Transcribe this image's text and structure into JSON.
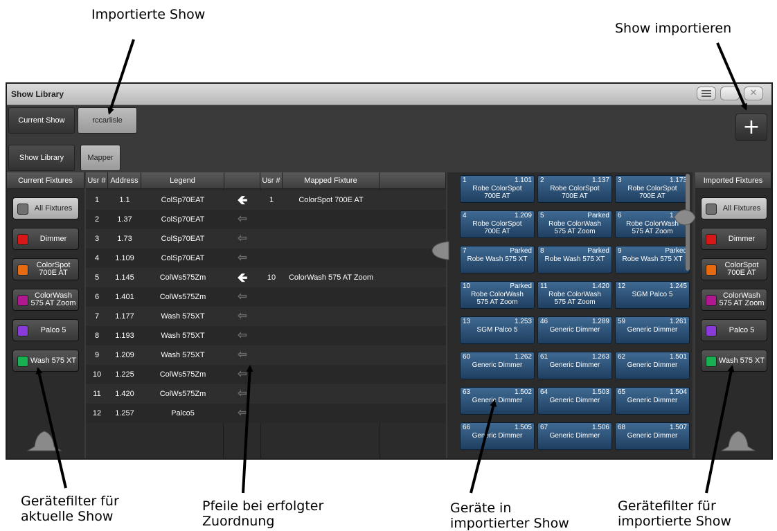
{
  "annotations": {
    "imported_show": "Importierte Show",
    "import_show": "Show importieren",
    "filter_current_1": "Gerätefilter für",
    "filter_current_2": "aktuelle Show",
    "arrows_1": "Pfeile bei erfolgter",
    "arrows_2": "Zuordnung",
    "fixtures_imported_1": "Geräte in",
    "fixtures_imported_2": "importierter Show",
    "filter_imported_1": "Gerätefilter für",
    "filter_imported_2": "importierte Show"
  },
  "window": {
    "title": "Show Library",
    "list_icon": "list-icon",
    "close_icon": "close-icon",
    "close_glyph": "✕"
  },
  "tabs_row1": [
    {
      "label": "Current Show",
      "active": false
    },
    {
      "label": "rccarlisle",
      "active": true
    }
  ],
  "tabs_row2": [
    {
      "label": "Show Library",
      "active": false
    },
    {
      "label": "Mapper",
      "active": true
    }
  ],
  "import_button": {
    "label": "+",
    "icon": "plus-icon"
  },
  "headers": {
    "current_fixtures": "Current Fixtures",
    "usr": "Usr #",
    "address": "Address",
    "legend": "Legend",
    "usr2": "Usr #",
    "mapped_fixture": "Mapped Fixture",
    "imported_fixtures": "Imported Fixtures"
  },
  "current_filters": [
    {
      "label": "All Fixtures",
      "color": "#707070",
      "selected": true
    },
    {
      "label": "Dimmer",
      "color": "#d81818",
      "selected": false
    },
    {
      "label": "ColorSpot\n700E AT",
      "color": "#e86a10",
      "selected": false
    },
    {
      "label": "ColorWash\n575 AT Zoom",
      "color": "#b01890",
      "selected": false
    },
    {
      "label": "Palco 5",
      "color": "#8a3ad8",
      "selected": false
    },
    {
      "label": "Wash 575 XT",
      "color": "#18b050",
      "selected": false
    }
  ],
  "imported_filters": [
    {
      "label": "All Fixtures",
      "color": "#707070",
      "selected": true
    },
    {
      "label": "Dimmer",
      "color": "#d81818",
      "selected": false
    },
    {
      "label": "ColorSpot\n700E AT",
      "color": "#e86a10",
      "selected": false
    },
    {
      "label": "ColorWash\n575 AT Zoom",
      "color": "#b01890",
      "selected": false
    },
    {
      "label": "Palco 5",
      "color": "#8a3ad8",
      "selected": false
    },
    {
      "label": "Wash 575 XT",
      "color": "#18b050",
      "selected": false
    }
  ],
  "mapping_rows": [
    {
      "usr": "1",
      "address": "1.1",
      "legend": "ColSp70EAT",
      "mapped": true,
      "mapped_usr": "1",
      "mapped_fixture": "ColorSpot 700E AT"
    },
    {
      "usr": "2",
      "address": "1.37",
      "legend": "ColSp70EAT",
      "mapped": false,
      "mapped_usr": "",
      "mapped_fixture": ""
    },
    {
      "usr": "3",
      "address": "1.73",
      "legend": "ColSp70EAT",
      "mapped": false,
      "mapped_usr": "",
      "mapped_fixture": ""
    },
    {
      "usr": "4",
      "address": "1.109",
      "legend": "ColSp70EAT",
      "mapped": false,
      "mapped_usr": "",
      "mapped_fixture": ""
    },
    {
      "usr": "5",
      "address": "1.145",
      "legend": "ColWs575Zm",
      "mapped": true,
      "mapped_usr": "10",
      "mapped_fixture": "ColorWash 575 AT Zoom"
    },
    {
      "usr": "6",
      "address": "1.401",
      "legend": "ColWs575Zm",
      "mapped": false,
      "mapped_usr": "",
      "mapped_fixture": ""
    },
    {
      "usr": "7",
      "address": "1.177",
      "legend": "Wash 575XT",
      "mapped": false,
      "mapped_usr": "",
      "mapped_fixture": ""
    },
    {
      "usr": "8",
      "address": "1.193",
      "legend": "Wash 575XT",
      "mapped": false,
      "mapped_usr": "",
      "mapped_fixture": ""
    },
    {
      "usr": "9",
      "address": "1.209",
      "legend": "Wash 575XT",
      "mapped": false,
      "mapped_usr": "",
      "mapped_fixture": ""
    },
    {
      "usr": "10",
      "address": "1.225",
      "legend": "ColWs575Zm",
      "mapped": false,
      "mapped_usr": "",
      "mapped_fixture": ""
    },
    {
      "usr": "11",
      "address": "1.420",
      "legend": "ColWs575Zm",
      "mapped": false,
      "mapped_usr": "",
      "mapped_fixture": ""
    },
    {
      "usr": "12",
      "address": "1.257",
      "legend": "Palco5",
      "mapped": false,
      "mapped_usr": "",
      "mapped_fixture": ""
    }
  ],
  "arrow_glyphs": {
    "mapped": "🡸",
    "unmapped": "⇦"
  },
  "imported_fixture_grid": [
    {
      "num": "1",
      "addr": "1.101",
      "name": "Robe ColorSpot\n700E AT"
    },
    {
      "num": "2",
      "addr": "1.137",
      "name": "Robe ColorSpot\n700E AT"
    },
    {
      "num": "3",
      "addr": "1.173",
      "name": "Robe ColorSpot\n700E AT"
    },
    {
      "num": "4",
      "addr": "1.209",
      "name": "Robe ColorSpot\n700E AT"
    },
    {
      "num": "5",
      "addr": "Parked",
      "name": "Robe ColorWash\n575 AT Zoom"
    },
    {
      "num": "6",
      "addr": "1.401",
      "name": "Robe ColorWash\n575 AT Zoom"
    },
    {
      "num": "7",
      "addr": "Parked",
      "name": "Robe Wash 575 XT"
    },
    {
      "num": "8",
      "addr": "Parked",
      "name": "Robe Wash 575 XT"
    },
    {
      "num": "9",
      "addr": "Parked",
      "name": "Robe Wash 575 XT"
    },
    {
      "num": "10",
      "addr": "Parked",
      "name": "Robe ColorWash\n575 AT Zoom"
    },
    {
      "num": "11",
      "addr": "1.420",
      "name": "Robe ColorWash\n575 AT Zoom"
    },
    {
      "num": "12",
      "addr": "1.245",
      "name": "SGM Palco 5"
    },
    {
      "num": "13",
      "addr": "1.253",
      "name": "SGM Palco 5"
    },
    {
      "num": "46",
      "addr": "1.289",
      "name": "Generic Dimmer"
    },
    {
      "num": "59",
      "addr": "1.261",
      "name": "Generic Dimmer"
    },
    {
      "num": "60",
      "addr": "1.262",
      "name": "Generic Dimmer"
    },
    {
      "num": "61",
      "addr": "1.263",
      "name": "Generic Dimmer"
    },
    {
      "num": "62",
      "addr": "1.501",
      "name": "Generic Dimmer"
    },
    {
      "num": "63",
      "addr": "1.502",
      "name": "Generic Dimmer"
    },
    {
      "num": "64",
      "addr": "1.503",
      "name": "Generic Dimmer"
    },
    {
      "num": "65",
      "addr": "1.504",
      "name": "Generic Dimmer"
    },
    {
      "num": "66",
      "addr": "1.505",
      "name": "Generic Dimmer"
    },
    {
      "num": "67",
      "addr": "1.506",
      "name": "Generic Dimmer"
    },
    {
      "num": "68",
      "addr": "1.507",
      "name": "Generic Dimmer"
    }
  ]
}
